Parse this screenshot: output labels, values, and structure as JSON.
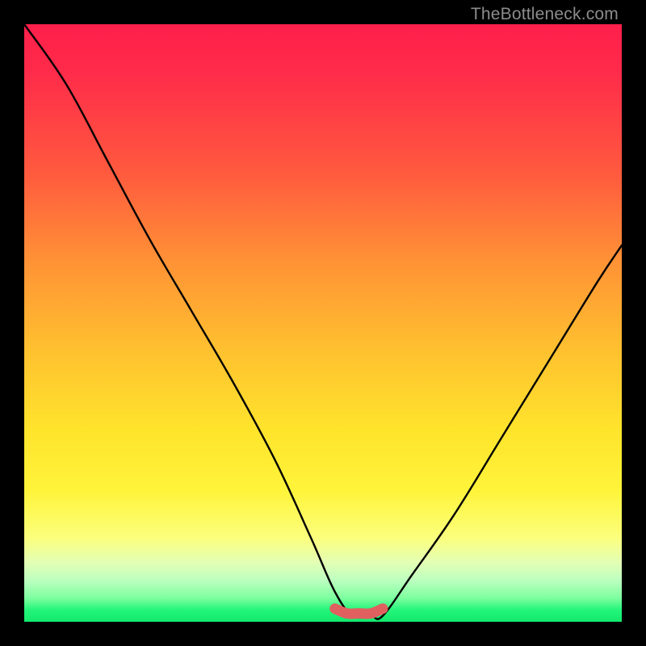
{
  "watermark": "TheBottleneck.com",
  "chart_data": {
    "type": "line",
    "title": "",
    "xlabel": "",
    "ylabel": "",
    "xlim": [
      0,
      100
    ],
    "ylim": [
      0,
      100
    ],
    "series": [
      {
        "name": "curve",
        "x": [
          0,
          7,
          14,
          21,
          28,
          35,
          42,
          48,
          52,
          55,
          58,
          60,
          65,
          72,
          80,
          88,
          96,
          100
        ],
        "values": [
          100,
          90,
          77,
          64,
          52,
          40,
          27,
          14,
          5,
          1,
          1,
          1,
          8,
          18,
          31,
          44,
          57,
          63
        ]
      },
      {
        "name": "highlight",
        "x": [
          52,
          54,
          56,
          58,
          60
        ],
        "values": [
          2.2,
          1.4,
          1.4,
          1.4,
          2.2
        ]
      }
    ],
    "colors": {
      "curve": "#000000",
      "highlight": "#e06060"
    }
  }
}
